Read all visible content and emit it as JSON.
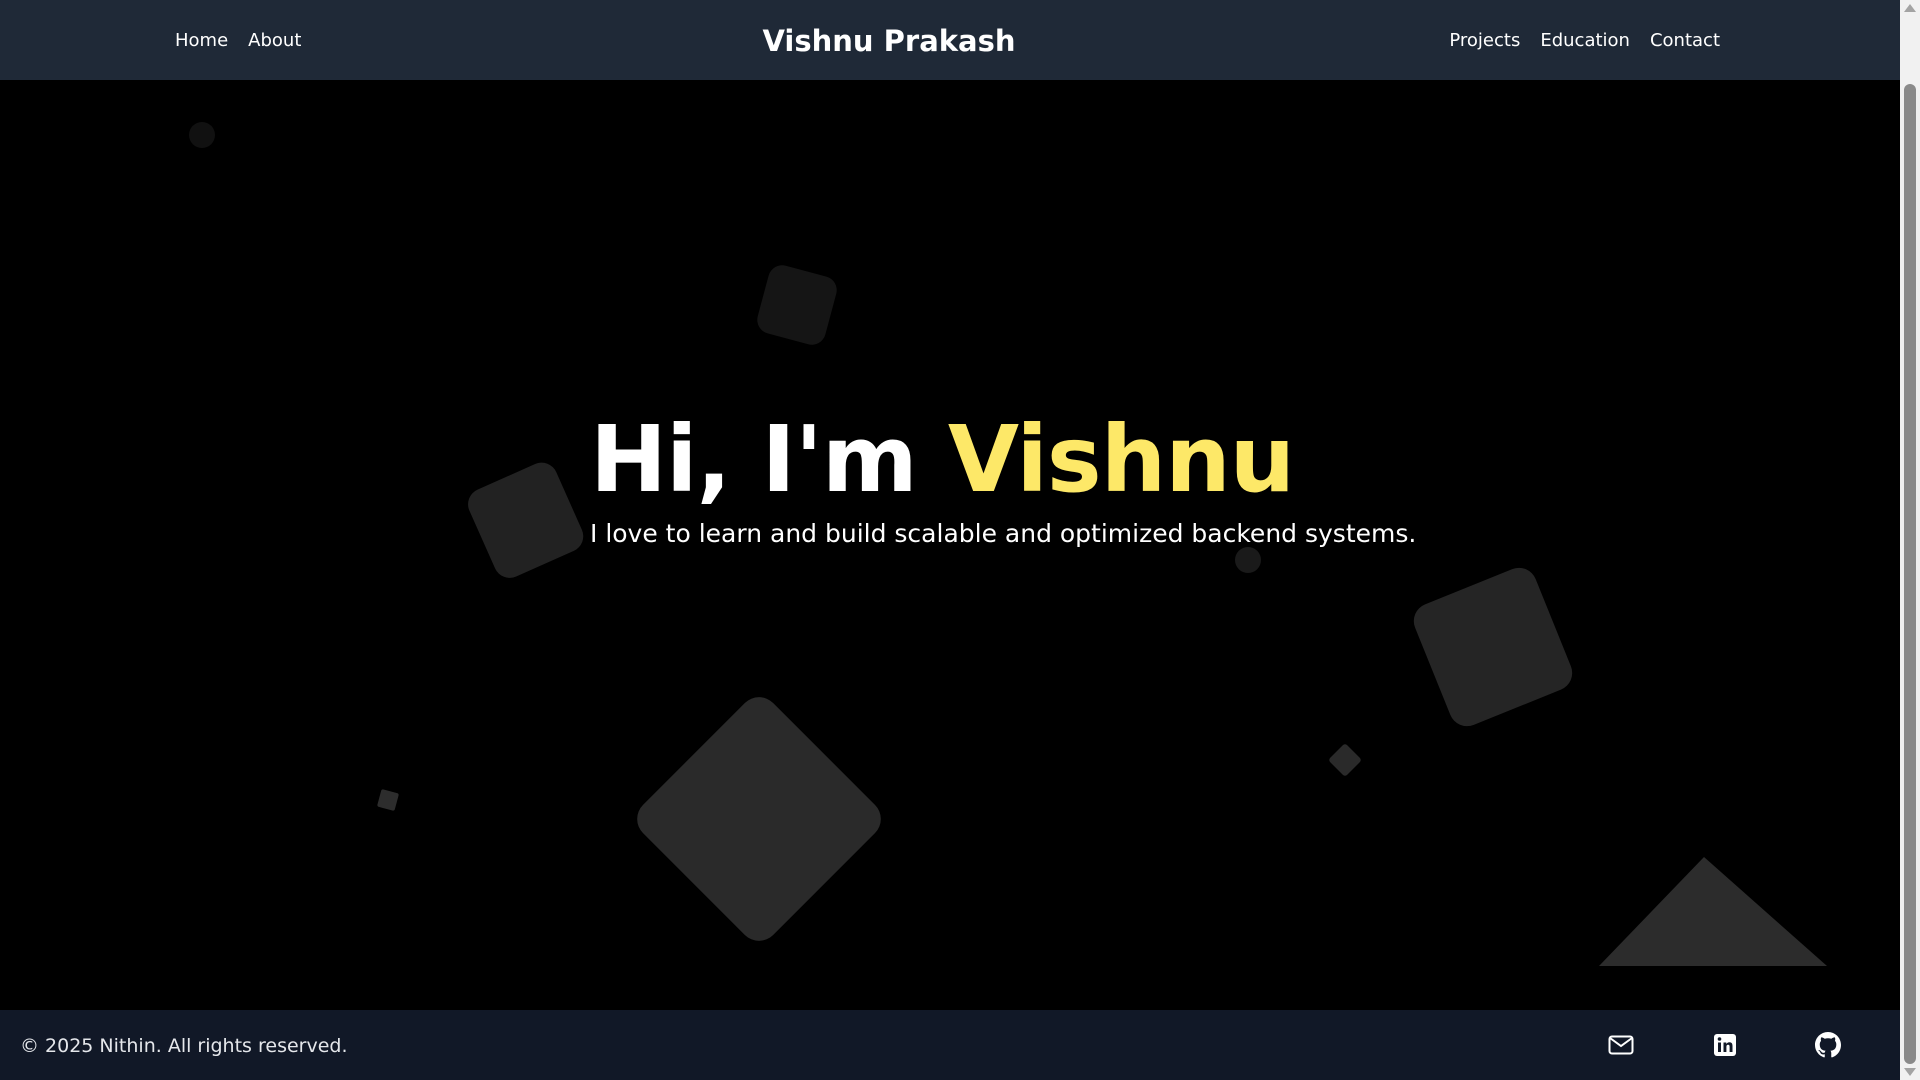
{
  "nav": {
    "brand": "Vishnu Prakash",
    "left_links": [
      "Home",
      "About"
    ],
    "right_links": [
      "Projects",
      "Education",
      "Contact"
    ]
  },
  "hero": {
    "greeting": "Hi, I'm",
    "name": "Vishnu",
    "subtitle": "I love to learn and build scalable and optimized backend systems."
  },
  "footer": {
    "copyright": "© 2025 Nithin. All rights reserved.",
    "social_icons": [
      "mail-icon",
      "linkedin-icon",
      "github-icon"
    ]
  },
  "colors": {
    "nav_bg": "#1f2937",
    "footer_bg": "#111827",
    "accent": "#fde868",
    "shape": "#2a2a2a"
  }
}
